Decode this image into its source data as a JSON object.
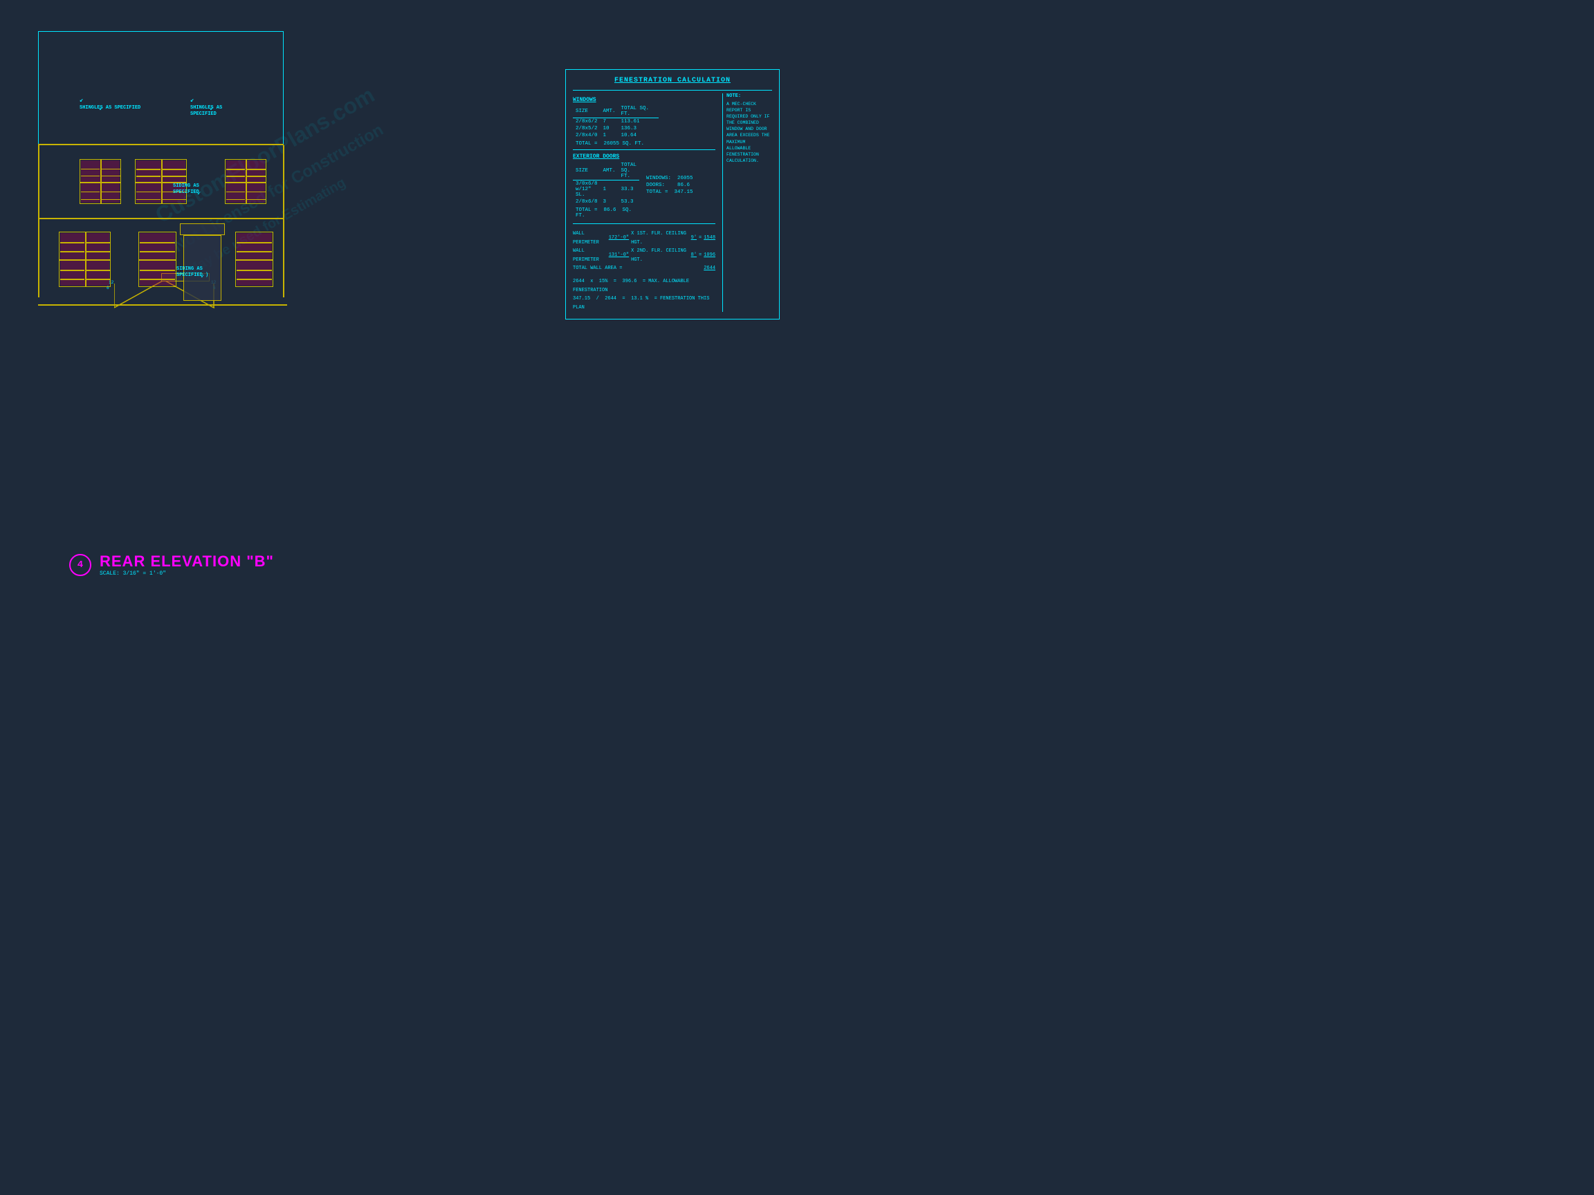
{
  "page": {
    "background": "#1e2a3a",
    "title": "REAR ELEVATION \"B\"",
    "scale": "SCALE: 3/16\" = 1'-0\"",
    "drawing_number": "4"
  },
  "labels": {
    "shingles_left": "SHINGLES AS\nSPECIFIED",
    "shingles_right": "SHINGLES AS\nSPECIFIED",
    "siding_upper": "SIDING AS\nSPECIFIED",
    "siding_lower": "SIDING AS\nSPECIFIED )"
  },
  "fenestration": {
    "title": "FENESTRATION CALCULATION",
    "windows_section": "WINDOWS",
    "windows_headers": [
      "SIZE",
      "AMT.",
      "TOTAL SQ. FT."
    ],
    "windows_data": [
      {
        "size": "2/8x6/2",
        "amt": "7",
        "total": "113.61"
      },
      {
        "size": "2/8x5/2",
        "amt": "10",
        "total": "136.3"
      },
      {
        "size": "2/8x4/0",
        "amt": "1",
        "total": "10.64"
      }
    ],
    "windows_total": "TOTAL = 26055 SQ. FT.",
    "doors_section": "EXTERIOR DOORS",
    "doors_headers": [
      "SIZE",
      "AMT.",
      "TOTAL SQ. FT."
    ],
    "doors_data": [
      {
        "size": "3/0x6/8\nw/12\" SL.",
        "amt": "1",
        "total": "33.3"
      },
      {
        "size": "2/8x6/8",
        "amt": "3",
        "total": "53.3"
      }
    ],
    "doors_total": "TOTAL = 86.6 SQ. FT.",
    "summary": {
      "windows": "WINDOWS: 26055",
      "doors": "DOORS: 86.6",
      "total": "TOTAL = 347.15"
    },
    "note_title": "NOTE:",
    "note_text": "A MEC-CHECK REPORT IS REQUIRED ONLY IF THE COMBINED WINDOW AND DOOR AREA EXCEEDS THE MAXIMUM ALLOWABLE FENESTRATION CALCULATION.",
    "wall_calcs": [
      "WALL PERIMETER 172'-0\" X 1ST. FLR. CEILING HGT. 9' = 1548",
      "WALL PERIMETER 131'-0\" X 2ND. FLR. CEILING HGT. 8' = 1096",
      "TOTAL WALL AREA = 2644"
    ],
    "fenes_calcs": [
      "2644 x 15% = 396.6 = MAX. ALLOWABLE FENESTRATION",
      "347.15 / 2644 = 13.1 % = FENESTRATION THIS PLAN"
    ]
  },
  "watermark": {
    "line1": "CustomFloorPlans.com",
    "line2": "Not Licensed for Construction",
    "line3": "May be used for Estimating"
  }
}
